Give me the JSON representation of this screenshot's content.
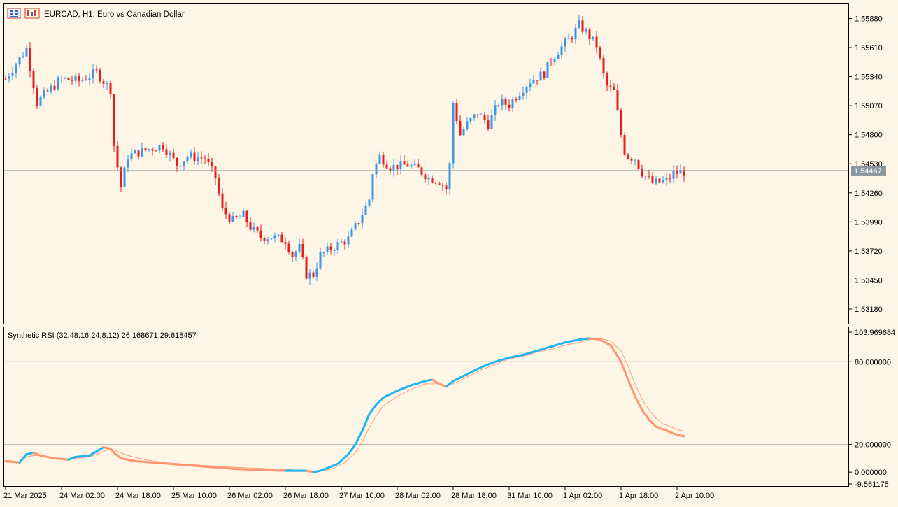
{
  "window": {
    "title": "EURCAD, H1:  Euro vs Canadian Dollar"
  },
  "colors": {
    "background": "#fdf6e6",
    "bull": "#3c96e6",
    "bear": "#e61e1e",
    "rsi_main": "#1eb4f0",
    "rsi_down": "#ff9670",
    "grid_level": "#b4b4b4",
    "price_line": "#a0a0a0",
    "price_tag": "#8c96a0"
  },
  "price_axis": {
    "labels": [
      "1.55880",
      "1.55610",
      "1.55340",
      "1.55070",
      "1.54800",
      "1.54530",
      "1.54260",
      "1.53990",
      "1.53720",
      "1.53450",
      "1.53180"
    ],
    "current_price": "1.54467"
  },
  "indicator": {
    "title": "Synthetic RSI (32,48,16,24,8,12) 26.168671 29.618457",
    "axis_labels": [
      "103.969684",
      "80.000000",
      "20.000000",
      "0.000000",
      "-9.561175"
    ],
    "levels": [
      80,
      20
    ]
  },
  "time_axis": {
    "labels": [
      "21 Mar 2025",
      "24 Mar 02:00",
      "24 Mar 18:00",
      "25 Mar 10:00",
      "26 Mar 02:00",
      "26 Mar 18:00",
      "27 Mar 10:00",
      "28 Mar 02:00",
      "28 Mar 18:00",
      "31 Mar 10:00",
      "1 Apr 02:00",
      "1 Apr 18:00",
      "2 Apr 10:00"
    ]
  },
  "chart_data": [
    {
      "type": "candlestick",
      "title": "EURCAD, H1:  Euro vs Canadian Dollar",
      "ylim": [
        1.5305,
        1.56
      ],
      "close_path": [
        [
          0,
          1.5532
        ],
        [
          6,
          1.556
        ],
        [
          9,
          1.551
        ],
        [
          12,
          1.552
        ],
        [
          16,
          1.5532
        ],
        [
          21,
          1.553
        ],
        [
          26,
          1.5538
        ],
        [
          30,
          1.5522
        ],
        [
          31,
          1.547
        ],
        [
          32,
          1.545
        ],
        [
          33,
          1.5432
        ],
        [
          35,
          1.546
        ],
        [
          40,
          1.5466
        ],
        [
          45,
          1.547
        ],
        [
          49,
          1.5452
        ],
        [
          52,
          1.546
        ],
        [
          57,
          1.5458
        ],
        [
          60,
          1.544
        ],
        [
          62,
          1.541
        ],
        [
          65,
          1.54
        ],
        [
          68,
          1.5405
        ],
        [
          70,
          1.5394
        ],
        [
          73,
          1.5385
        ],
        [
          76,
          1.5385
        ],
        [
          80,
          1.5382
        ],
        [
          82,
          1.5368
        ],
        [
          84,
          1.5375
        ],
        [
          86,
          1.535
        ],
        [
          88,
          1.535
        ],
        [
          90,
          1.5368
        ],
        [
          92,
          1.5372
        ],
        [
          95,
          1.5378
        ],
        [
          98,
          1.5383
        ],
        [
          101,
          1.54
        ],
        [
          104,
          1.542
        ],
        [
          105,
          1.5445
        ],
        [
          107,
          1.546
        ],
        [
          110,
          1.545
        ],
        [
          115,
          1.5452
        ],
        [
          118,
          1.5448
        ],
        [
          121,
          1.544
        ],
        [
          124,
          1.5437
        ],
        [
          126,
          1.543
        ],
        [
          127,
          1.5452
        ],
        [
          128,
          1.551
        ],
        [
          130,
          1.548
        ],
        [
          132,
          1.549
        ],
        [
          135,
          1.55
        ],
        [
          138,
          1.549
        ],
        [
          141,
          1.551
        ],
        [
          144,
          1.5508
        ],
        [
          147,
          1.552
        ],
        [
          150,
          1.553
        ],
        [
          154,
          1.5537
        ],
        [
          156,
          1.555
        ],
        [
          158,
          1.5558
        ],
        [
          162,
          1.5572
        ],
        [
          164,
          1.5582
        ],
        [
          166,
          1.5575
        ],
        [
          169,
          1.5563
        ],
        [
          171,
          1.5535
        ],
        [
          172,
          1.5525
        ],
        [
          174,
          1.552
        ],
        [
          176,
          1.548
        ],
        [
          177,
          1.5465
        ],
        [
          178,
          1.546
        ],
        [
          180,
          1.5458
        ],
        [
          182,
          1.5445
        ],
        [
          185,
          1.5435
        ],
        [
          189,
          1.5437
        ],
        [
          191,
          1.5444
        ],
        [
          194,
          1.5446
        ]
      ],
      "bars": 195,
      "current_price": 1.54467
    },
    {
      "type": "line",
      "title": "Synthetic RSI (32,48,16,24,8,12) 26.168671 29.618457",
      "ylim": [
        -9.561175,
        103.969684
      ],
      "levels": [
        80,
        20
      ],
      "series": [
        {
          "values": [
            [
              0,
              8
            ],
            [
              4,
              7
            ],
            [
              6,
              13
            ],
            [
              8,
              14
            ],
            [
              10,
              12
            ],
            [
              14,
              10
            ],
            [
              18,
              9
            ],
            [
              20,
              11
            ],
            [
              24,
              12
            ],
            [
              28,
              18
            ],
            [
              30,
              17
            ],
            [
              31,
              14
            ],
            [
              33,
              10
            ],
            [
              37,
              8
            ],
            [
              42,
              7
            ],
            [
              47,
              6
            ],
            [
              52,
              5
            ],
            [
              57,
              4
            ],
            [
              62,
              3
            ],
            [
              68,
              2
            ],
            [
              80,
              1
            ],
            [
              86,
              1
            ],
            [
              88,
              0
            ],
            [
              90,
              1
            ],
            [
              92,
              3
            ],
            [
              95,
              6
            ],
            [
              98,
              13
            ],
            [
              100,
              20
            ],
            [
              102,
              30
            ],
            [
              104,
              42
            ],
            [
              106,
              49
            ],
            [
              108,
              54
            ],
            [
              112,
              59
            ],
            [
              116,
              63
            ],
            [
              120,
              66
            ],
            [
              122,
              67
            ],
            [
              124,
              64
            ],
            [
              126,
              62
            ],
            [
              128,
              66
            ],
            [
              132,
              71
            ],
            [
              136,
              76
            ],
            [
              140,
              80
            ],
            [
              144,
              83
            ],
            [
              148,
              85
            ],
            [
              152,
              88
            ],
            [
              156,
              91
            ],
            [
              160,
              94
            ],
            [
              164,
              96
            ],
            [
              167,
              97
            ],
            [
              170,
              96
            ],
            [
              173,
              92
            ],
            [
              176,
              80
            ],
            [
              178,
              67
            ],
            [
              180,
              55
            ],
            [
              182,
              45
            ],
            [
              184,
              38
            ],
            [
              186,
              33
            ],
            [
              188,
              31
            ],
            [
              190,
              29
            ],
            [
              192,
              27
            ],
            [
              194,
              26
            ]
          ]
        },
        {
          "values": [
            [
              0,
              7
            ],
            [
              4,
              7
            ],
            [
              6,
              11
            ],
            [
              8,
              12
            ],
            [
              10,
              12
            ],
            [
              14,
              10
            ],
            [
              18,
              9
            ],
            [
              20,
              10
            ],
            [
              24,
              11
            ],
            [
              28,
              15
            ],
            [
              30,
              17
            ],
            [
              32,
              15
            ],
            [
              35,
              12
            ],
            [
              40,
              9
            ],
            [
              45,
              7
            ],
            [
              50,
              6
            ],
            [
              56,
              5
            ],
            [
              62,
              4
            ],
            [
              70,
              3
            ],
            [
              80,
              2
            ],
            [
              86,
              1
            ],
            [
              88,
              1
            ],
            [
              91,
              1
            ],
            [
              94,
              3
            ],
            [
              97,
              7
            ],
            [
              100,
              14
            ],
            [
              102,
              22
            ],
            [
              104,
              32
            ],
            [
              106,
              41
            ],
            [
              108,
              48
            ],
            [
              112,
              55
            ],
            [
              116,
              60
            ],
            [
              120,
              64
            ],
            [
              124,
              64
            ],
            [
              126,
              62
            ],
            [
              128,
              64
            ],
            [
              132,
              69
            ],
            [
              136,
              74
            ],
            [
              140,
              78
            ],
            [
              144,
              82
            ],
            [
              148,
              84
            ],
            [
              152,
              87
            ],
            [
              156,
              89
            ],
            [
              160,
              92
            ],
            [
              164,
              94
            ],
            [
              167,
              96
            ],
            [
              170,
              97
            ],
            [
              173,
              95
            ],
            [
              176,
              88
            ],
            [
              178,
              77
            ],
            [
              180,
              64
            ],
            [
              182,
              53
            ],
            [
              184,
              45
            ],
            [
              186,
              39
            ],
            [
              188,
              35
            ],
            [
              190,
              33
            ],
            [
              192,
              31
            ],
            [
              194,
              29.6
            ]
          ]
        }
      ]
    }
  ]
}
